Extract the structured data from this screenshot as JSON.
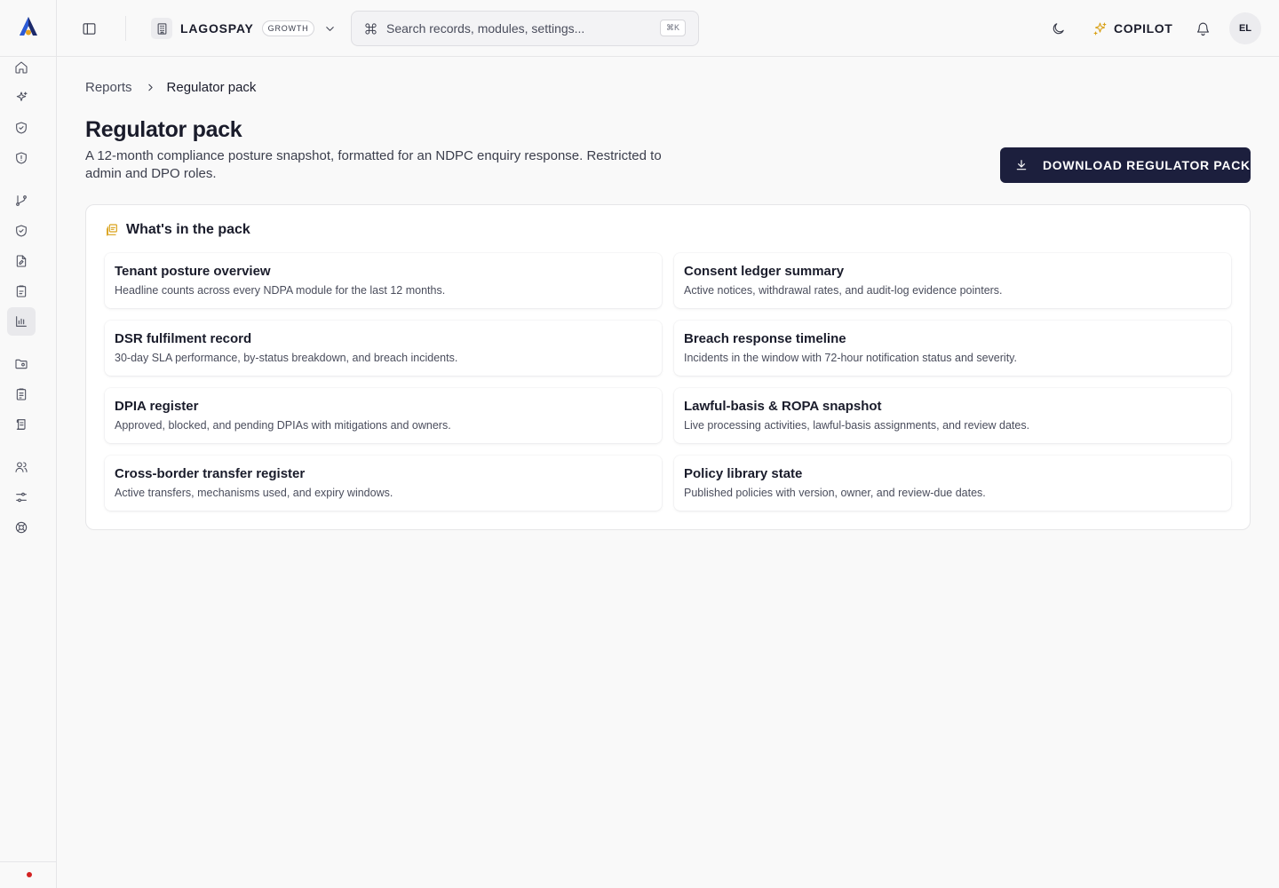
{
  "topbar": {
    "tenant_name": "LAGOSPAY",
    "tenant_plan": "GROWTH",
    "search_placeholder": "Search records, modules, settings...",
    "search_shortcut": "⌘K",
    "copilot_label": "COPILOT",
    "avatar_initials": "EL"
  },
  "sidebar": {
    "items": [
      {
        "icon": "home-icon"
      },
      {
        "icon": "sparkles-icon"
      },
      {
        "icon": "shield-check-icon"
      },
      {
        "icon": "shield-alert-icon"
      },
      {
        "icon": "git-branch-icon"
      },
      {
        "icon": "shield-check-icon"
      },
      {
        "icon": "file-edit-icon"
      },
      {
        "icon": "clipboard-icon"
      },
      {
        "icon": "bar-chart-icon",
        "active": true
      },
      {
        "icon": "folder-icon"
      },
      {
        "icon": "clipboard-list-icon"
      },
      {
        "icon": "scroll-icon"
      },
      {
        "icon": "users-icon"
      },
      {
        "icon": "sliders-icon"
      },
      {
        "icon": "life-buoy-icon"
      }
    ],
    "status_color": "#d32222"
  },
  "breadcrumb": {
    "parent": "Reports",
    "current": "Regulator pack"
  },
  "page": {
    "title": "Regulator pack",
    "description": "A 12-month compliance posture snapshot, formatted for an NDPC enquiry response. Restricted to admin and DPO roles.",
    "download_label": "DOWNLOAD REGULATOR PACK"
  },
  "panel": {
    "title": "What's in the pack",
    "cards": [
      {
        "title": "Tenant posture overview",
        "desc": "Headline counts across every NDPA module for the last 12 months."
      },
      {
        "title": "Consent ledger summary",
        "desc": "Active notices, withdrawal rates, and audit-log evidence pointers."
      },
      {
        "title": "DSR fulfilment record",
        "desc": "30-day SLA performance, by-status breakdown, and breach incidents."
      },
      {
        "title": "Breach response timeline",
        "desc": "Incidents in the window with 72-hour notification status and severity."
      },
      {
        "title": "DPIA register",
        "desc": "Approved, blocked, and pending DPIAs with mitigations and owners."
      },
      {
        "title": "Lawful-basis & ROPA snapshot",
        "desc": "Live processing activities, lawful-basis assignments, and review dates."
      },
      {
        "title": "Cross-border transfer register",
        "desc": "Active transfers, mechanisms used, and expiry windows."
      },
      {
        "title": "Policy library state",
        "desc": "Published policies with version, owner, and review-due dates."
      }
    ]
  },
  "colors": {
    "brand_navy": "#1c1f3d",
    "accent_gold": "#d9a21b",
    "brand_blue": "#2b5bd7"
  }
}
